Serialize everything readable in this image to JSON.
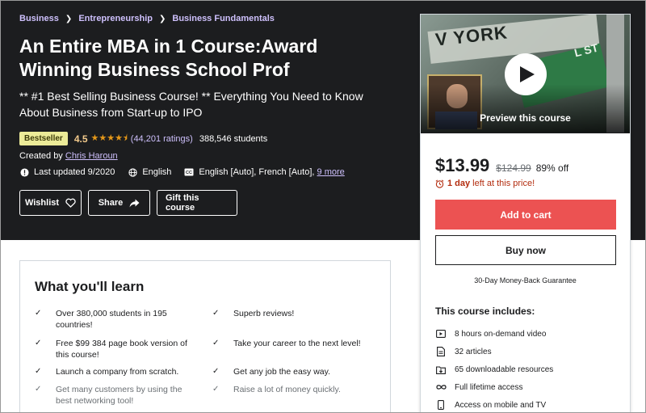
{
  "breadcrumb": [
    "Business",
    "Entrepreneurship",
    "Business Fundamentals"
  ],
  "course": {
    "title": "An Entire MBA in 1 Course:Award Winning Business School Prof",
    "subtitle": "** #1 Best Selling Business Course! ** Everything You Need to Know About Business from Start-up to IPO",
    "badge": "Bestseller",
    "rating": "4.5",
    "stars": 4.5,
    "rating_count": "(44,201 ratings)",
    "students": "388,546 students",
    "created_by_label": "Created by",
    "instructor": "Chris Haroun",
    "last_updated": "Last updated 9/2020",
    "language": "English",
    "captions": "English [Auto], French [Auto],",
    "captions_more": "9 more"
  },
  "actions": {
    "wishlist": "Wishlist",
    "share": "Share",
    "gift": "Gift this course"
  },
  "preview": {
    "sign_text": "V YORK",
    "street_text": "L ST",
    "label": "Preview this course"
  },
  "purchase": {
    "price": "$13.99",
    "original_price": "$124.99",
    "discount": "89% off",
    "timer_bold": "1 day",
    "timer_rest": "left at this price!",
    "add_to_cart": "Add to cart",
    "buy_now": "Buy now",
    "guarantee": "30-Day Money-Back Guarantee"
  },
  "includes": {
    "title": "This course includes:",
    "items": [
      {
        "icon": "video-icon",
        "text": "8 hours on-demand video"
      },
      {
        "icon": "article-icon",
        "text": "32 articles"
      },
      {
        "icon": "download-icon",
        "text": "65 downloadable resources"
      },
      {
        "icon": "infinity-icon",
        "text": "Full lifetime access"
      },
      {
        "icon": "mobile-icon",
        "text": "Access on mobile and TV"
      }
    ]
  },
  "learn": {
    "title": "What you'll learn",
    "left": [
      "Over 380,000 students in 195 countries!",
      "Free $99 384 page book version of this course!",
      "Launch a company from scratch.",
      "Get many customers by using the best networking tool!"
    ],
    "right": [
      "Superb reviews!",
      "Take your career to the next level!",
      "Get any job the easy way.",
      "Raise a lot of money quickly."
    ]
  },
  "colors": {
    "hero_bg": "#1c1d1f",
    "link_purple": "#cec0fc",
    "star_gold": "#e59819",
    "cart_red": "#ec5252",
    "badge_yellow": "#eceb98"
  }
}
